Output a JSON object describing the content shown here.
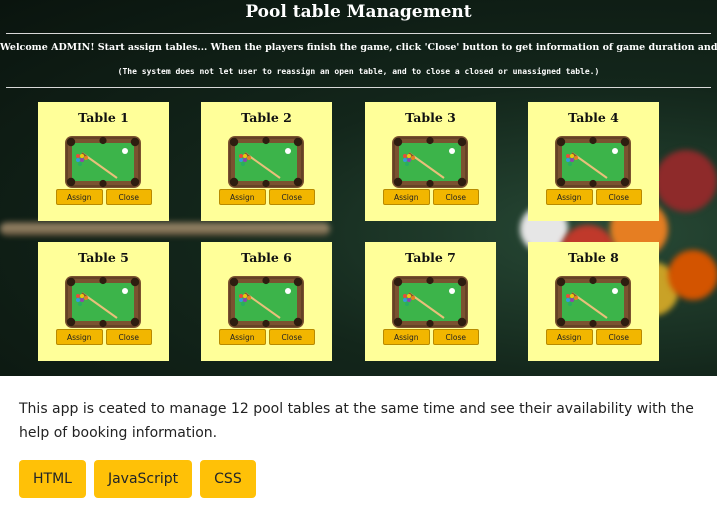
{
  "header": {
    "title": "Pool table Management",
    "welcome": "Welcome ADMIN! Start assign tables... When the players finish the game, click 'Close' button to get information of game duration and cost.",
    "notice": "(The system does not let user to reassign an open table, and to close a closed or unassigned table.)"
  },
  "tables": [
    {
      "label": "Table 1",
      "assign": "Assign",
      "close": "Close"
    },
    {
      "label": "Table 2",
      "assign": "Assign",
      "close": "Close"
    },
    {
      "label": "Table 3",
      "assign": "Assign",
      "close": "Close"
    },
    {
      "label": "Table 4",
      "assign": "Assign",
      "close": "Close"
    },
    {
      "label": "Table 5",
      "assign": "Assign",
      "close": "Close"
    },
    {
      "label": "Table 6",
      "assign": "Assign",
      "close": "Close"
    },
    {
      "label": "Table 7",
      "assign": "Assign",
      "close": "Close"
    },
    {
      "label": "Table 8",
      "assign": "Assign",
      "close": "Close"
    }
  ],
  "description": "This app is ceated to manage 12 pool tables at the same time and see their availability with the help of booking information.",
  "tags": [
    "HTML",
    "JavaScript",
    "CSS"
  ],
  "colors": {
    "card_background": "#ffff99",
    "card_button": "#f2b600",
    "tag_button": "#ffc107",
    "felt": "#3cb44a",
    "rail": "#7a5230"
  },
  "icons": {
    "table": "pool-table-icon"
  }
}
